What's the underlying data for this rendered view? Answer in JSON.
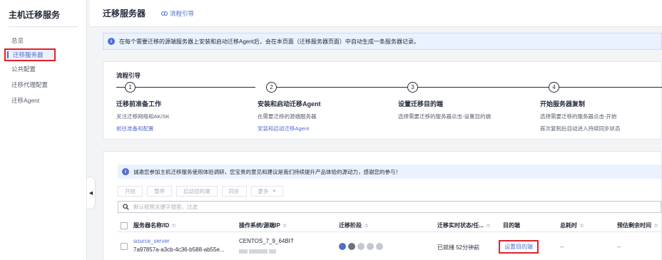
{
  "sidebar": {
    "title": "主机迁移服务",
    "items": [
      {
        "label": "总览"
      },
      {
        "label": "迁移服务器"
      },
      {
        "label": "公共配置"
      },
      {
        "label": "迁移代理配置"
      },
      {
        "label": "迁移Agent"
      }
    ]
  },
  "header": {
    "title": "迁移服务器",
    "guide_link": "流程引导"
  },
  "notice": {
    "text": "在每个需要迁移的源端服务器上安装和启动迁移Agent后，会在本页面（迁移服务器页面）中自动生成一条服务器记录。"
  },
  "guide": {
    "title": "流程引导",
    "steps": [
      {
        "num": "1",
        "title": "迁移前准备工作",
        "line1": "关注迁移网络和AK/SK",
        "link": "前往准备和配置"
      },
      {
        "num": "2",
        "title": "安装和启动迁移Agent",
        "line1": "在需要迁移的源端服务器",
        "link": "安装和启动迁移Agent"
      },
      {
        "num": "3",
        "title": "设置迁移目的端",
        "line1": "选择需要迁移的服务器点击-设置目的端"
      },
      {
        "num": "4",
        "title": "开始服务器复制",
        "line1": "选择需要迁移的服务器点击-开始",
        "line2": "首次复制后自动进入持续同步状态"
      }
    ]
  },
  "survey": {
    "text": "诚邀您参加主机迁移服务使用体验调研，您宝贵的意见和建议是我们持续提升产品体验的源动力，感谢您的参与！"
  },
  "toolbar": {
    "start": "开始",
    "pause": "暂停",
    "start_target": "启动目的端",
    "sync": "同步",
    "more": "更多"
  },
  "search": {
    "placeholder": "默认按照关键字搜索、过滤"
  },
  "table": {
    "headers": {
      "name": "服务器名称/ID",
      "os": "操作系统/源端IP",
      "stage": "迁移阶段",
      "status": "迁移实时状态/任...",
      "target": "目的端",
      "elapsed": "总耗时",
      "remaining": "预估剩余时间"
    },
    "rows": [
      {
        "name": "source_server",
        "id": "7a97857a-a3cb-4c36-b588-ab55e...",
        "os": "CENTOS_7_9_64BIT",
        "status": "已就绪 52分钟前",
        "target": "设置目的端",
        "elapsed": "--",
        "remaining": "--"
      }
    ]
  },
  "colors": {
    "accent": "#526ecc",
    "highlight_border": "#e0222a",
    "notice_bg": "#eaf2ff"
  }
}
